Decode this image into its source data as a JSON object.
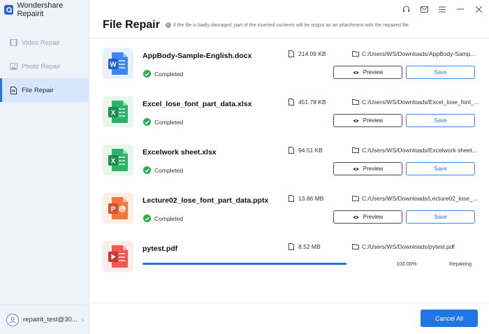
{
  "app": {
    "name": "Wondershare Repairit"
  },
  "sidebar": {
    "items": [
      {
        "label": "Video Repair",
        "icon": "video-icon",
        "active": false
      },
      {
        "label": "Photo Repair",
        "icon": "photo-icon",
        "active": false
      },
      {
        "label": "File Repair",
        "icon": "file-icon",
        "active": true
      }
    ],
    "user": {
      "name": "repairit_test@30..."
    }
  },
  "header": {
    "title": "File Repair",
    "note": "If the file is badly damaged, part of the inserted contents will be output as an attachment with the repaired file."
  },
  "files": [
    {
      "name": "AppBody-Sample-English.docx",
      "type": "word",
      "status": "Completed",
      "size": "214.09  KB",
      "path": "C:/Users/WS/Downloads/AppBody-Samp...",
      "preview_label": "Preview",
      "save_label": "Save"
    },
    {
      "name": "Excel_lose_font_part_data.xlsx",
      "type": "excel",
      "status": "Completed",
      "size": "451.78  KB",
      "path": "C:/Users/WS/Downloads/Excel_lose_font_...",
      "preview_label": "Preview",
      "save_label": "Save"
    },
    {
      "name": "Excelwork sheet.xlsx",
      "type": "excel",
      "status": "Completed",
      "size": "94.51  KB",
      "path": "C:/Users/WS/Downloads/Excelwork sheet...",
      "preview_label": "Preview",
      "save_label": "Save"
    },
    {
      "name": "Lecture02_lose_font_part_data.pptx",
      "type": "powerpoint",
      "status": "Completed",
      "size": "13.86  MB",
      "path": "C:/Users/WS/Downloads/Lecture02_lose_...",
      "preview_label": "Preview",
      "save_label": "Save"
    },
    {
      "name": "pytest.pdf",
      "type": "pdf",
      "size": "8.52  MB",
      "path": "C:/Users/WS/Downloads/pytest.pdf",
      "progress_text": "100.00%",
      "progress": 1.0,
      "state_text": "Repairing"
    }
  ],
  "footer": {
    "cancel_all_label": "Cancel All"
  },
  "colors": {
    "accent": "#1f76e6",
    "success": "#2aae4f",
    "word": "#2b6fde",
    "excel": "#1f9d55",
    "powerpoint": "#e8623a",
    "pdf": "#e34b3f"
  }
}
